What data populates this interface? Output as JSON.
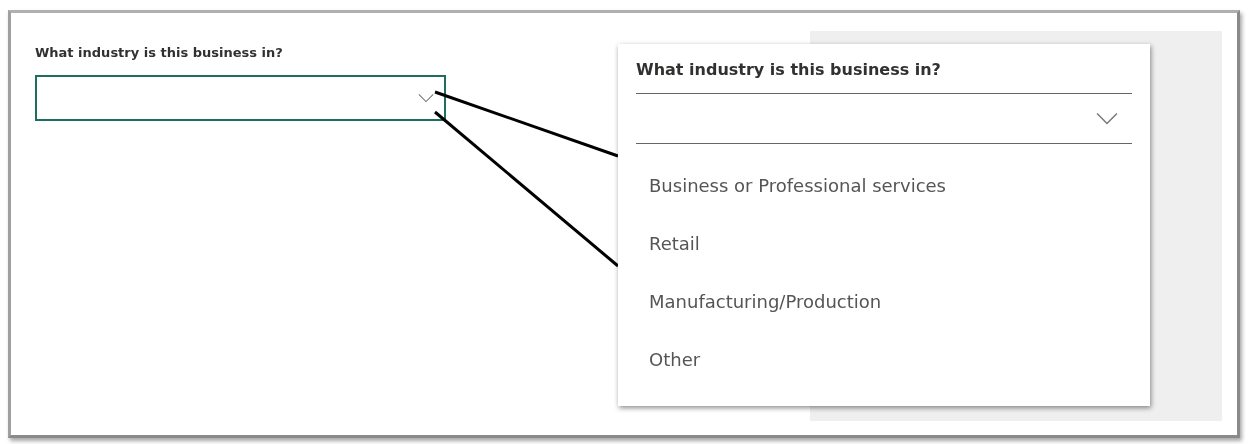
{
  "form": {
    "label": "What industry is this business in?",
    "expanded": false
  },
  "callout": {
    "label": "What industry is this business in?",
    "expanded": true,
    "options": [
      {
        "label": "Business or Professional services",
        "selected": false
      },
      {
        "label": "Retail",
        "selected": false
      },
      {
        "label": "Manufacturing/Production",
        "selected": false
      },
      {
        "label": "Other",
        "selected": false
      }
    ]
  }
}
